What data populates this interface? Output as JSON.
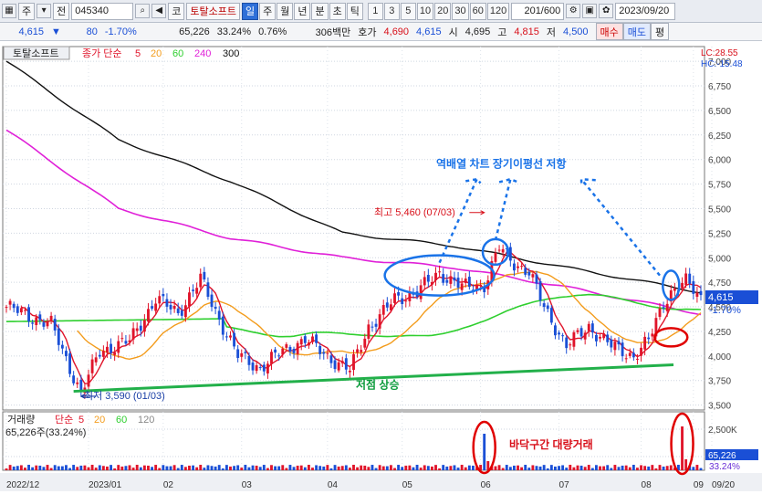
{
  "toolbar": {
    "market": "주",
    "period_btn": "전",
    "code": "045340",
    "market_type": "코",
    "name": "토탈소프트",
    "period_tabs": [
      "일",
      "주",
      "월",
      "년",
      "분",
      "초",
      "틱"
    ],
    "selected_period": "일",
    "intervals": [
      "1",
      "3",
      "5",
      "10",
      "20",
      "30",
      "60",
      "120"
    ],
    "count": "201/600",
    "date": "2023/09/20"
  },
  "quote": {
    "price": "4,615",
    "change": "80",
    "change_pct": "-1.70%",
    "volume": "65,226",
    "turnover_pct": "33.24%",
    "ratio": "0.76%",
    "amount": "306백만",
    "bid_label": "호가",
    "bid": "4,690",
    "ask": "4,615",
    "open_label": "시",
    "open": "4,695",
    "high_label": "고",
    "high": "4,815",
    "low_label": "저",
    "low": "4,500",
    "buy": "매수",
    "sell": "매도",
    "eval": "평"
  },
  "legend": {
    "stock": "토탈소프트",
    "ma_label": "종가 단순",
    "ma": [
      {
        "period": "5",
        "color": "#e0142a"
      },
      {
        "period": "20",
        "color": "#f39c1c"
      },
      {
        "period": "60",
        "color": "#2fcf2f"
      },
      {
        "period": "240",
        "color": "#e020d8"
      },
      {
        "period": "300",
        "color": "#111111"
      }
    ],
    "lc": "LC:28.55",
    "hc": "HC:-15.48"
  },
  "volume_legend": {
    "label": "거래량",
    "ma_label": "단순",
    "ma": [
      {
        "period": "5",
        "color": "#e0142a"
      },
      {
        "period": "20",
        "color": "#f39c1c"
      },
      {
        "period": "60",
        "color": "#2fcf2f"
      },
      {
        "period": "120",
        "color": "#888888"
      }
    ],
    "current": "65,226주(33.24%)",
    "last_box": "65,226",
    "last_pct": "33.24%"
  },
  "price_box": {
    "value": "4,615",
    "change": "-1.70%"
  },
  "chart_data": {
    "type": "candlestick",
    "x_ticks": [
      "2022/12",
      "2023/01",
      "02",
      "03",
      "04",
      "05",
      "06",
      "07",
      "08",
      "09",
      "09/20"
    ],
    "y_ticks": [
      3500,
      3750,
      4000,
      4250,
      4500,
      4750,
      5000,
      5250,
      5500,
      5750,
      6000,
      6250,
      6500,
      6750,
      7000
    ],
    "ylim": [
      3450,
      7150
    ],
    "vol_ticks": [
      "2,500K",
      "1,000K"
    ],
    "anchors": [
      {
        "i": 0,
        "c": 4500
      },
      {
        "i": 12,
        "c": 4320
      },
      {
        "i": 20,
        "c": 3620
      },
      {
        "i": 25,
        "c": 4050
      },
      {
        "i": 33,
        "c": 4150
      },
      {
        "i": 40,
        "c": 4580
      },
      {
        "i": 46,
        "c": 4440
      },
      {
        "i": 52,
        "c": 4780
      },
      {
        "i": 58,
        "c": 4300
      },
      {
        "i": 62,
        "c": 4000
      },
      {
        "i": 68,
        "c": 3880
      },
      {
        "i": 74,
        "c": 4050
      },
      {
        "i": 80,
        "c": 4170
      },
      {
        "i": 86,
        "c": 4000
      },
      {
        "i": 92,
        "c": 3850
      },
      {
        "i": 97,
        "c": 4300
      },
      {
        "i": 100,
        "c": 4400
      },
      {
        "i": 104,
        "c": 4580
      },
      {
        "i": 110,
        "c": 4650
      },
      {
        "i": 116,
        "c": 4850
      },
      {
        "i": 122,
        "c": 4700
      },
      {
        "i": 128,
        "c": 4720
      },
      {
        "i": 132,
        "c": 5100
      },
      {
        "i": 136,
        "c": 4950
      },
      {
        "i": 140,
        "c": 4850
      },
      {
        "i": 144,
        "c": 4500
      },
      {
        "i": 150,
        "c": 4100
      },
      {
        "i": 156,
        "c": 4300
      },
      {
        "i": 162,
        "c": 4100
      },
      {
        "i": 168,
        "c": 4000
      },
      {
        "i": 172,
        "c": 4150
      },
      {
        "i": 176,
        "c": 4550
      },
      {
        "i": 178,
        "c": 4650
      },
      {
        "i": 182,
        "c": 4750
      },
      {
        "i": 186,
        "c": 4600
      }
    ],
    "ma240_points": [
      [
        0,
        6300
      ],
      [
        30,
        5500
      ],
      [
        60,
        5200
      ],
      [
        90,
        5000
      ],
      [
        120,
        4900
      ],
      [
        150,
        4700
      ],
      [
        186,
        4430
      ]
    ],
    "ma300_points": [
      [
        0,
        7000
      ],
      [
        30,
        6200
      ],
      [
        60,
        5780
      ],
      [
        90,
        5250
      ],
      [
        120,
        5120
      ],
      [
        150,
        4900
      ],
      [
        186,
        4650
      ]
    ],
    "annotations": {
      "max": "최고 5,460 (07/03)",
      "min": "최저 3,590 (01/03)",
      "resistance": "역배열 차트 장기이평선 저항",
      "support": "저점 상승",
      "volume_note": "바닥구간 대량거래"
    }
  }
}
